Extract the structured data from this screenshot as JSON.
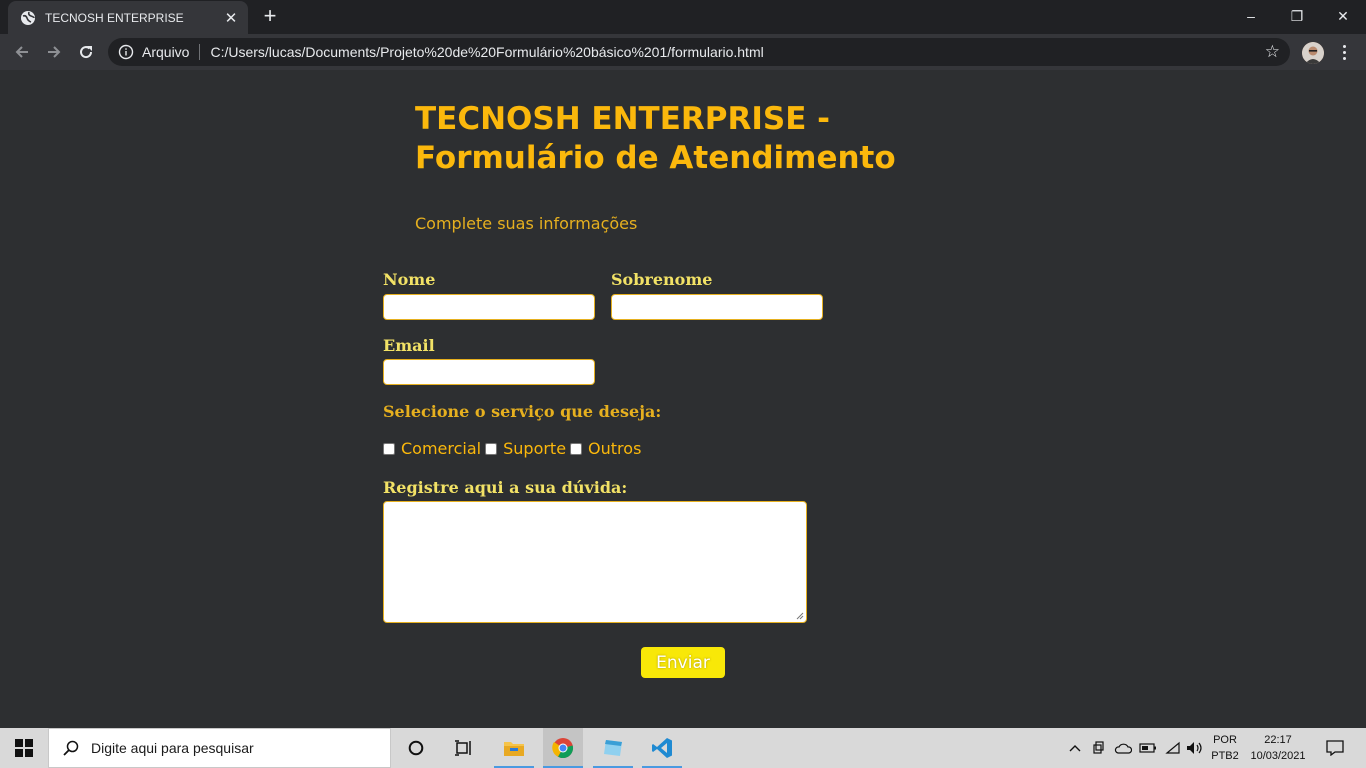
{
  "browser": {
    "tab_title": "TECNOSH ENTERPRISE",
    "tab_close": "✕",
    "new_tab": "+",
    "origin_label": "Arquivo",
    "url": "C:/Users/lucas/Documents/Projeto%20de%20Formulário%20básico%201/formulario.html",
    "window_controls": {
      "minimize": "–",
      "restore": "❐",
      "close": "✕"
    }
  },
  "page": {
    "title": "TECNOSH ENTERPRISE - Formulário de Atendimento",
    "subtitle": "Complete suas informações",
    "form": {
      "first_name_label": "Nome",
      "last_name_label": "Sobrenome",
      "email_label": "Email",
      "service_label": "Selecione o serviço que deseja:",
      "services": [
        "Comercial",
        "Suporte",
        "Outros"
      ],
      "question_label": "Registre aqui a sua dúvida:",
      "submit_label": "Enviar"
    }
  },
  "taskbar": {
    "search_placeholder": "Digite aqui para pesquisar",
    "language": "POR",
    "keyboard": "PTB2",
    "time": "22:17",
    "date": "10/03/2021"
  },
  "colors": {
    "background": "#2d2f31",
    "title": "#fbb80c",
    "label": "#f2e266",
    "submit": "#f8e808"
  }
}
